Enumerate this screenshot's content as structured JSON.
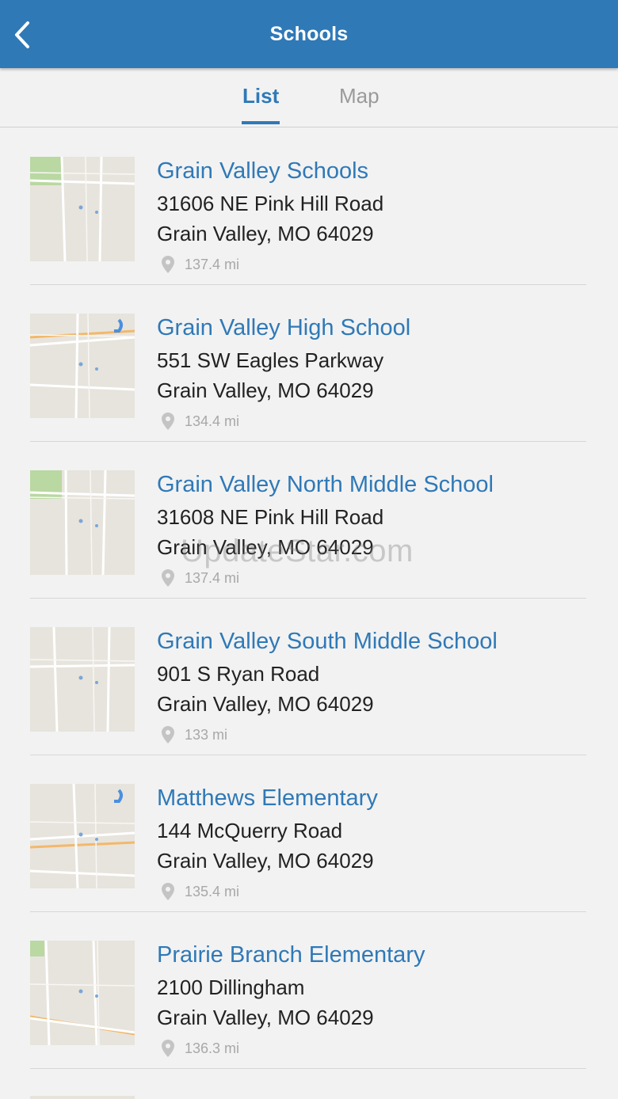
{
  "header": {
    "title": "Schools"
  },
  "tabs": [
    {
      "label": "List",
      "active": true
    },
    {
      "label": "Map",
      "active": false
    }
  ],
  "schools": [
    {
      "name": "Grain Valley Schools",
      "address1": "31606 NE Pink Hill Road",
      "address2": "Grain Valley, MO 64029",
      "distance": "137.4 mi"
    },
    {
      "name": "Grain Valley High School",
      "address1": "551 SW Eagles Parkway",
      "address2": "Grain Valley, MO 64029",
      "distance": "134.4 mi"
    },
    {
      "name": "Grain Valley North Middle School",
      "address1": "31608 NE Pink Hill Road",
      "address2": "Grain Valley, MO 64029",
      "distance": "137.4 mi"
    },
    {
      "name": "Grain Valley South Middle School",
      "address1": "901 S Ryan Road",
      "address2": "Grain Valley, MO 64029",
      "distance": "133 mi"
    },
    {
      "name": "Matthews Elementary",
      "address1": "144 McQuerry Road",
      "address2": "Grain Valley, MO 64029",
      "distance": "135.4 mi"
    },
    {
      "name": "Prairie Branch Elementary",
      "address1": "2100 Dillingham",
      "address2": "Grain Valley, MO 64029",
      "distance": "136.3 mi"
    }
  ],
  "watermark": "UpdateStar.com",
  "colors": {
    "brand": "#2f79b7",
    "background": "#f2f2f2",
    "text": "#222222",
    "muted": "#a8a8a8"
  },
  "icons": {
    "back": "chevron-left-icon",
    "distance": "map-pin-icon",
    "thumbnail": "map-thumbnail"
  }
}
